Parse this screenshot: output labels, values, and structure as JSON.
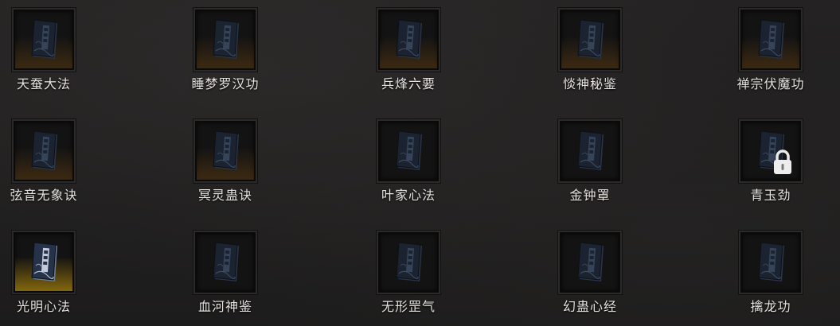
{
  "skills": [
    {
      "name": "天蚕大法",
      "glow": "brown",
      "locked": false,
      "book": "dark"
    },
    {
      "name": "睡梦罗汉功",
      "glow": "brown",
      "locked": false,
      "book": "dark"
    },
    {
      "name": "兵烽六要",
      "glow": "brown",
      "locked": false,
      "book": "dark"
    },
    {
      "name": "惔神秘鉴",
      "glow": "brown",
      "locked": false,
      "book": "dark"
    },
    {
      "name": "禅宗伏魔功",
      "glow": "brown",
      "locked": false,
      "book": "dark"
    },
    {
      "name": "弦音无象诀",
      "glow": "brown",
      "locked": false,
      "book": "dark"
    },
    {
      "name": "冥灵蛊诀",
      "glow": "brown",
      "locked": false,
      "book": "dark"
    },
    {
      "name": "叶家心法",
      "glow": "none",
      "locked": false,
      "book": "dark"
    },
    {
      "name": "金钟罩",
      "glow": "none",
      "locked": false,
      "book": "dark"
    },
    {
      "name": "青玉劲",
      "glow": "none",
      "locked": true,
      "book": "dark"
    },
    {
      "name": "光明心法",
      "glow": "gold",
      "locked": false,
      "book": "bright"
    },
    {
      "name": "血河神鉴",
      "glow": "none",
      "locked": false,
      "book": "dark"
    },
    {
      "name": "无形罡气",
      "glow": "none",
      "locked": false,
      "book": "dark"
    },
    {
      "name": "幻蛊心经",
      "glow": "none",
      "locked": false,
      "book": "dark"
    },
    {
      "name": "擒龙功",
      "glow": "none",
      "locked": false,
      "book": "dark"
    }
  ],
  "icons": {
    "book": "book-icon",
    "lock": "lock-icon"
  },
  "colors": {
    "label": "#e6e3df",
    "glow_brown": "#5f3e12",
    "glow_gold": "#96760c"
  }
}
